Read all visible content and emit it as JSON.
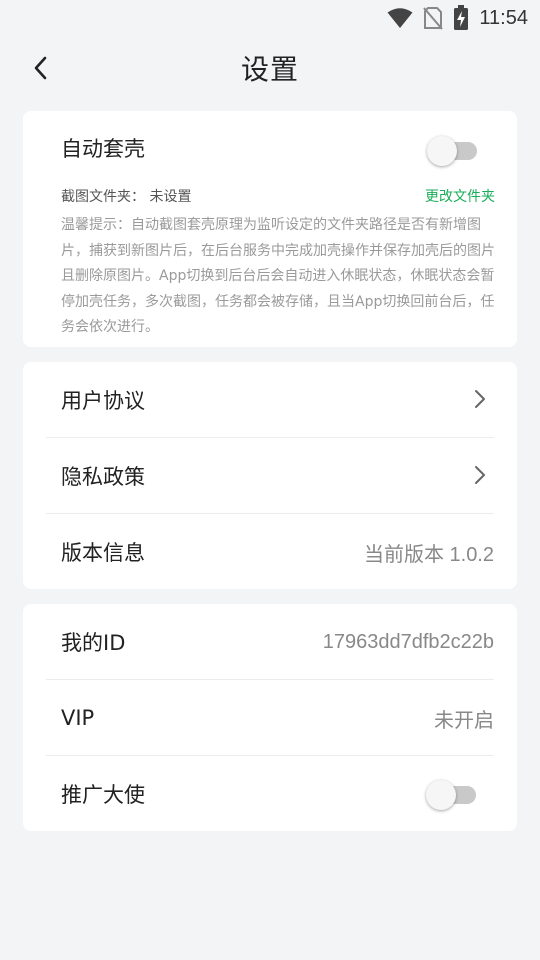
{
  "status_bar": {
    "time": "11:54"
  },
  "header": {
    "title": "设置"
  },
  "auto_shell": {
    "label": "自动套壳",
    "enabled": false,
    "folder_label": "截图文件夹：  未设置",
    "change_folder": "更改文件夹",
    "tip": "温馨提示：自动截图套壳原理为监听设定的文件夹路径是否有新增图片，捕获到新图片后，在后台服务中完成加壳操作并保存加壳后的图片且删除原图片。App切换到后台后会自动进入休眠状态，休眠状态会暂停加壳任务，多次截图，任务都会被存储，且当App切换回前台后，任务会依次进行。"
  },
  "general": {
    "items": [
      {
        "label": "用户协议"
      },
      {
        "label": "隐私政策"
      },
      {
        "label": "版本信息",
        "value": "当前版本 1.0.2"
      }
    ]
  },
  "account": {
    "id_label": "我的ID",
    "id_value": "17963dd7dfb2c22b",
    "vip_label": "VIP",
    "vip_value": "未开启",
    "ambassador_label": "推广大使",
    "ambassador_enabled": false
  },
  "colors": {
    "accent": "#1aad5a",
    "background": "#f3f4f6",
    "card": "#ffffff"
  },
  "icons": [
    "wifi-icon",
    "no-sim-icon",
    "battery-charging-icon",
    "back-arrow-icon",
    "chevron-right-icon"
  ]
}
